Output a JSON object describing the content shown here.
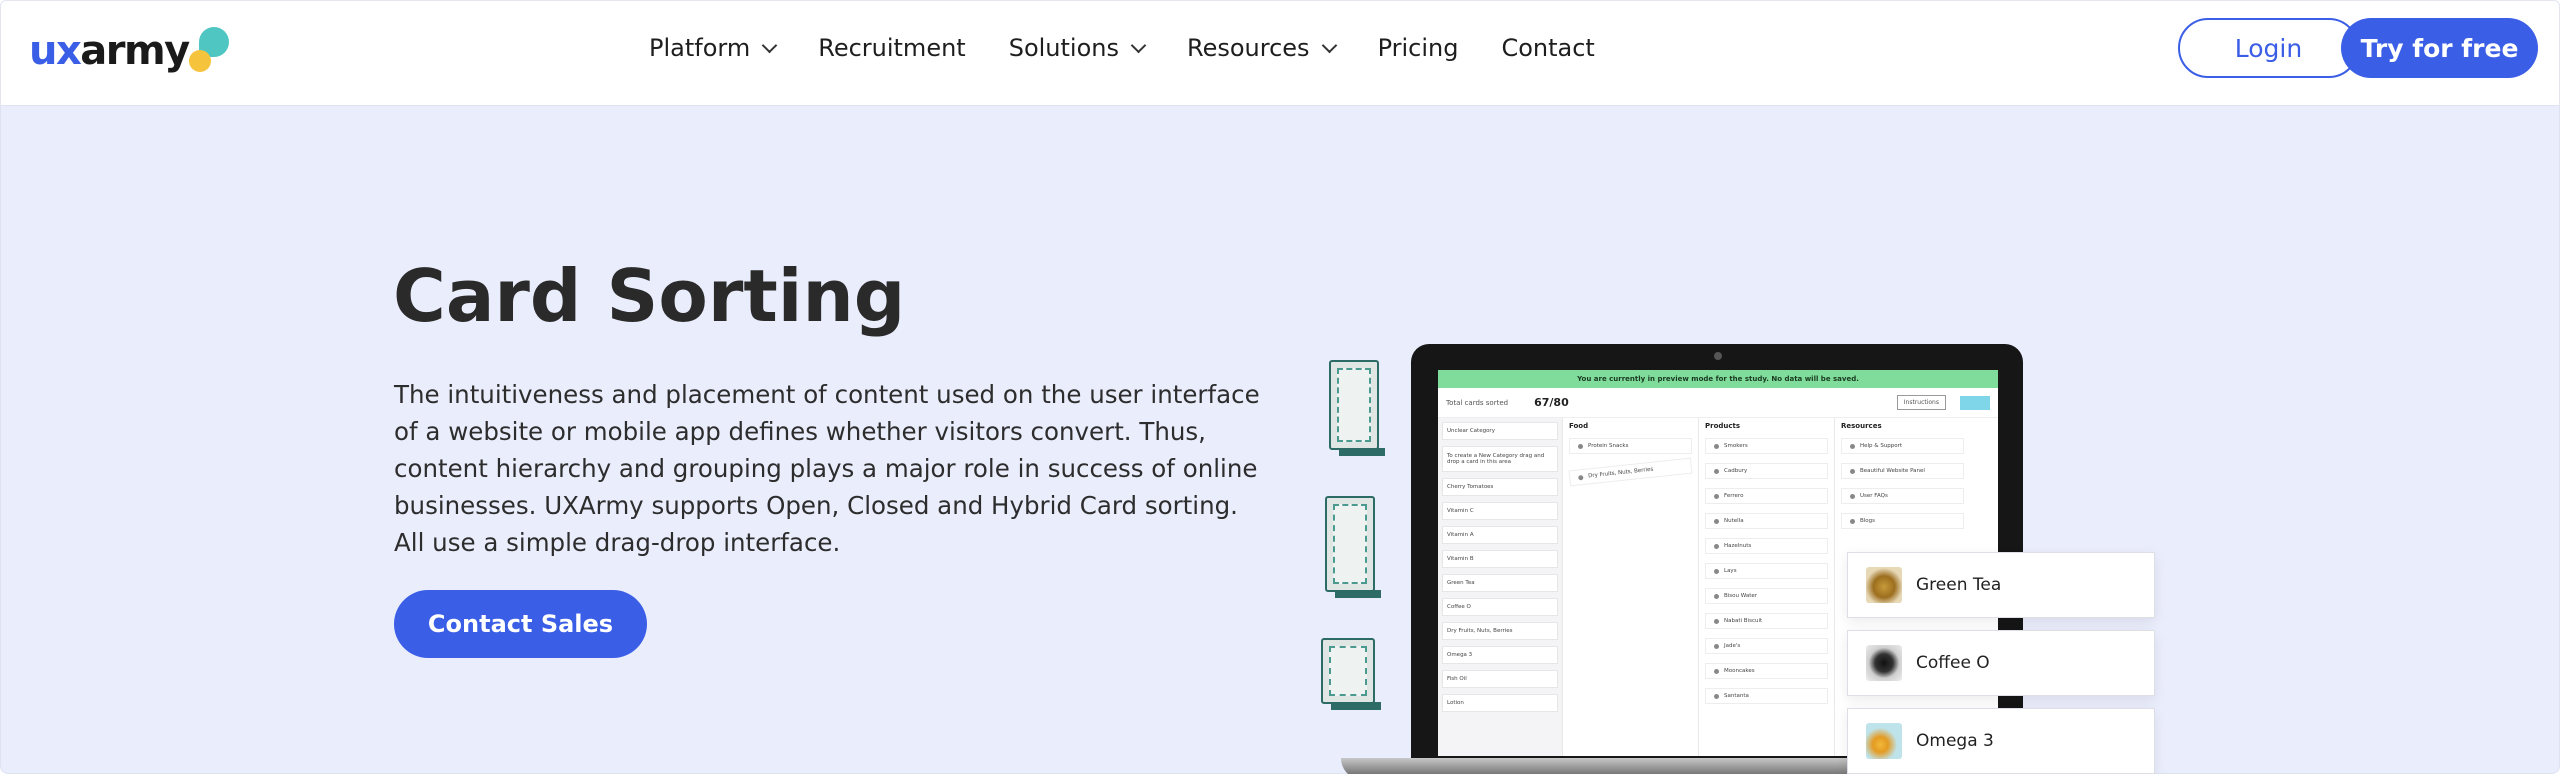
{
  "nav": {
    "logo": {
      "part1": "ux",
      "part2": "army"
    },
    "items": [
      {
        "label": "Platform",
        "has_dropdown": true
      },
      {
        "label": "Recruitment",
        "has_dropdown": false
      },
      {
        "label": "Solutions",
        "has_dropdown": true
      },
      {
        "label": "Resources",
        "has_dropdown": true
      },
      {
        "label": "Pricing",
        "has_dropdown": false
      },
      {
        "label": "Contact",
        "has_dropdown": false
      }
    ],
    "login": "Login",
    "try": "Try for free"
  },
  "hero": {
    "title": "Card Sorting",
    "description": "The intuitiveness and placement of content used on the user interface of a website or mobile app defines whether visitors convert. Thus, content hierarchy and grouping plays a major role in success of online businesses. UXArmy supports Open, Closed and Hybrid Card sorting. All use a simple drag-drop interface.",
    "cta": "Contact Sales"
  },
  "preview": {
    "banner": "You are currently in preview mode for the study. No data will be saved.",
    "total_label": "Total cards sorted",
    "total_value": "67/80",
    "instructions": "Instructions",
    "left_cards": [
      "Unclear Category",
      "To create a New Category drag and drop a card in this area",
      "Cherry Tomatoes",
      "Vitamin C",
      "Vitamin A",
      "Vitamin B",
      "Green Tea",
      "Coffee O",
      "Dry Fruits, Nuts, Berries",
      "Omega 3",
      "Fish Oil",
      "Lotion"
    ],
    "columns": [
      {
        "title": "Food",
        "cards": [
          "Protein Snacks",
          "Dry Fruits, Nuts, Berries"
        ]
      },
      {
        "title": "Products",
        "cards": [
          "Smokers",
          "Cadbury",
          "Ferrero",
          "Nutella",
          "Hazelnuts",
          "Lays",
          "Bisou Water",
          "Nabati Biscuit",
          "Jade's",
          "Mooncakes",
          "Santanta"
        ]
      },
      {
        "title": "Resources",
        "cards": [
          "Help & Support",
          "Beautiful Website Panel",
          "User FAQs",
          "Blogs"
        ]
      }
    ]
  },
  "floating_cards": [
    {
      "label": "Green Tea",
      "thumb": "green-tea"
    },
    {
      "label": "Coffee O",
      "thumb": "coffee"
    },
    {
      "label": "Omega 3",
      "thumb": "omega-3"
    }
  ],
  "colors": {
    "brand": "#3b5ee6",
    "hero_bg": "#eaedfc",
    "accent_teal": "#4fc6c2",
    "accent_yellow": "#f6c33c"
  }
}
